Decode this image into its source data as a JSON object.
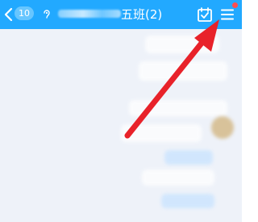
{
  "header": {
    "unread_count": "10",
    "group_name": "五班(2)",
    "background_color": "#22a9ff",
    "icons": [
      "back-chevron-icon",
      "voice-icon",
      "calendar-check-icon",
      "menu-icon"
    ],
    "notification_dot_color": "#ff4d4f"
  },
  "annotation": {
    "arrow_color": "#e8222a"
  }
}
